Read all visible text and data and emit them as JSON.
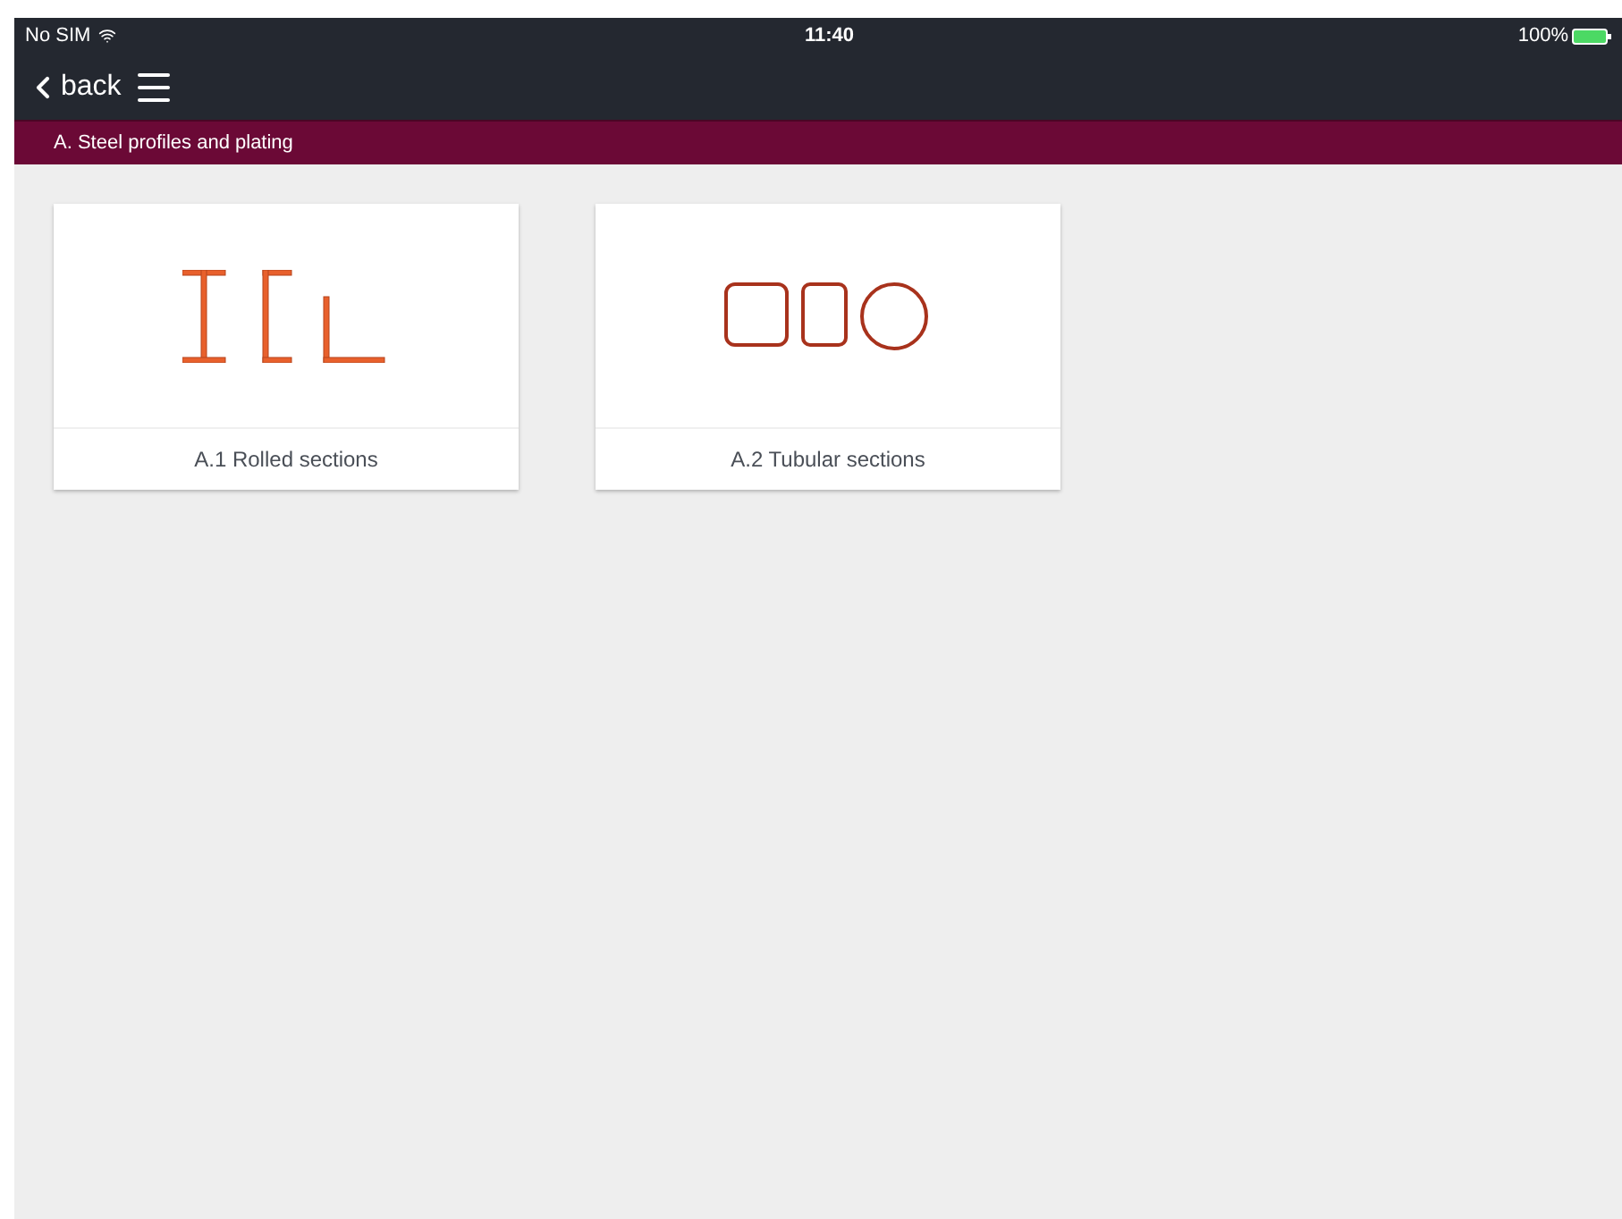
{
  "status_bar": {
    "carrier": "No SIM",
    "time": "11:40",
    "battery": "100%"
  },
  "nav": {
    "back": "back"
  },
  "section_bar": {
    "title": "A. Steel profiles and plating"
  },
  "cards": [
    {
      "kind": "rolled",
      "label": "A.1 Rolled sections"
    },
    {
      "kind": "tubular",
      "label": "A.2 Tubular sections"
    }
  ]
}
